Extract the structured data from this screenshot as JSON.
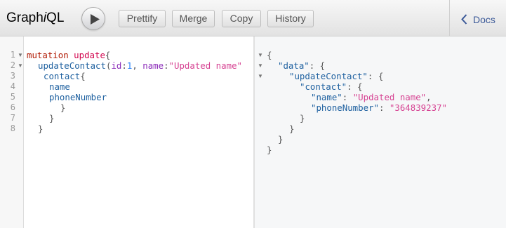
{
  "app": {
    "title_plain": "Graph",
    "title_italic": "i",
    "title_end": "QL"
  },
  "toolbar": {
    "prettify_label": "Prettify",
    "merge_label": "Merge",
    "copy_label": "Copy",
    "history_label": "History"
  },
  "docs": {
    "label": "Docs"
  },
  "icons": {
    "run": "play-icon",
    "docs": "chevron-left-icon"
  },
  "colors": {
    "keyword": "#b11a04",
    "definition": "#d2054e",
    "property": "#1f61a0",
    "attribute": "#8b2bb9",
    "number": "#2882f9",
    "string": "#d64292"
  },
  "editor": {
    "line_numbers": [
      "1",
      "2",
      "3",
      "4",
      "5",
      "6",
      "7",
      "8"
    ],
    "tokens": {
      "l1_kw": "mutation",
      "l1_name": "update",
      "l1_brace": "{",
      "l2_field": "updateContact",
      "l2_open": "(",
      "l2_arg1": "id",
      "l2_colon1": ":",
      "l2_val1": "1",
      "l2_comma": ", ",
      "l2_arg2": "name",
      "l2_colon2": ":",
      "l2_val2": "\"Updated name\"",
      "l3_field": "contact",
      "l3_brace": "{",
      "l4_field": "name",
      "l5_field": "phoneNumber",
      "l6": "}",
      "l7": "}",
      "l8": "}"
    }
  },
  "result": {
    "l1": "{",
    "l2_key": "\"data\"",
    "l2_rest": ": {",
    "l3_key": "\"updateContact\"",
    "l3_rest": ": {",
    "l4_key": "\"contact\"",
    "l4_rest": ": {",
    "l5_key": "\"name\"",
    "l5_sep": ": ",
    "l5_val": "\"Updated name\"",
    "l5_comma": ",",
    "l6_key": "\"phoneNumber\"",
    "l6_sep": ": ",
    "l6_val": "\"364839237\"",
    "l7": "}",
    "l8": "}",
    "l9": "}",
    "l10": "}"
  }
}
